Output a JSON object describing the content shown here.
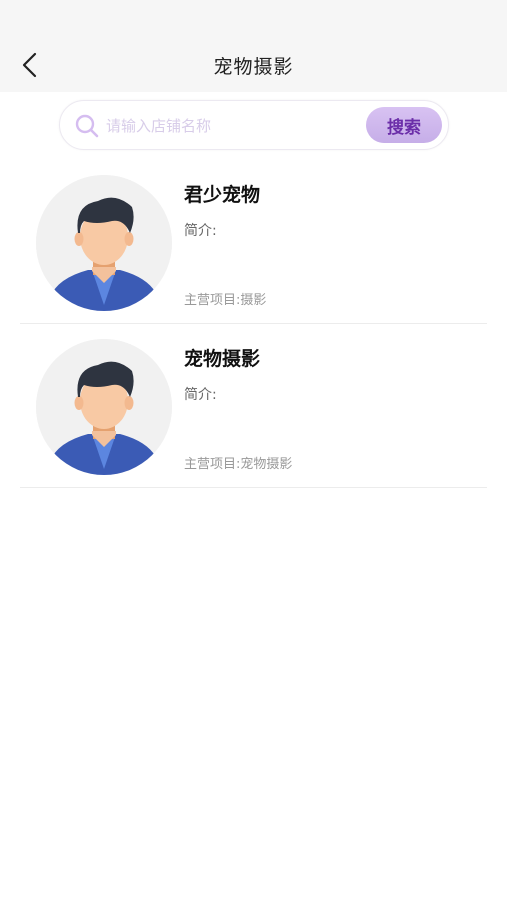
{
  "header": {
    "title": "宠物摄影",
    "back_icon": "chevron-left-icon"
  },
  "search": {
    "placeholder": "请输入店铺名称",
    "value": "",
    "button_label": "搜索",
    "icon": "search-icon"
  },
  "colors": {
    "accent": "#c9b0ea",
    "accent_text": "#6b2ea9",
    "placeholder": "#d8cde9"
  },
  "shops": [
    {
      "name": "君少宠物",
      "intro_label": "简介:",
      "intro": "",
      "main_label": "主营项目:",
      "main_value": "摄影"
    },
    {
      "name": "宠物摄影",
      "intro_label": "简介:",
      "intro": "",
      "main_label": "主营项目:",
      "main_value": "宠物摄影"
    }
  ]
}
